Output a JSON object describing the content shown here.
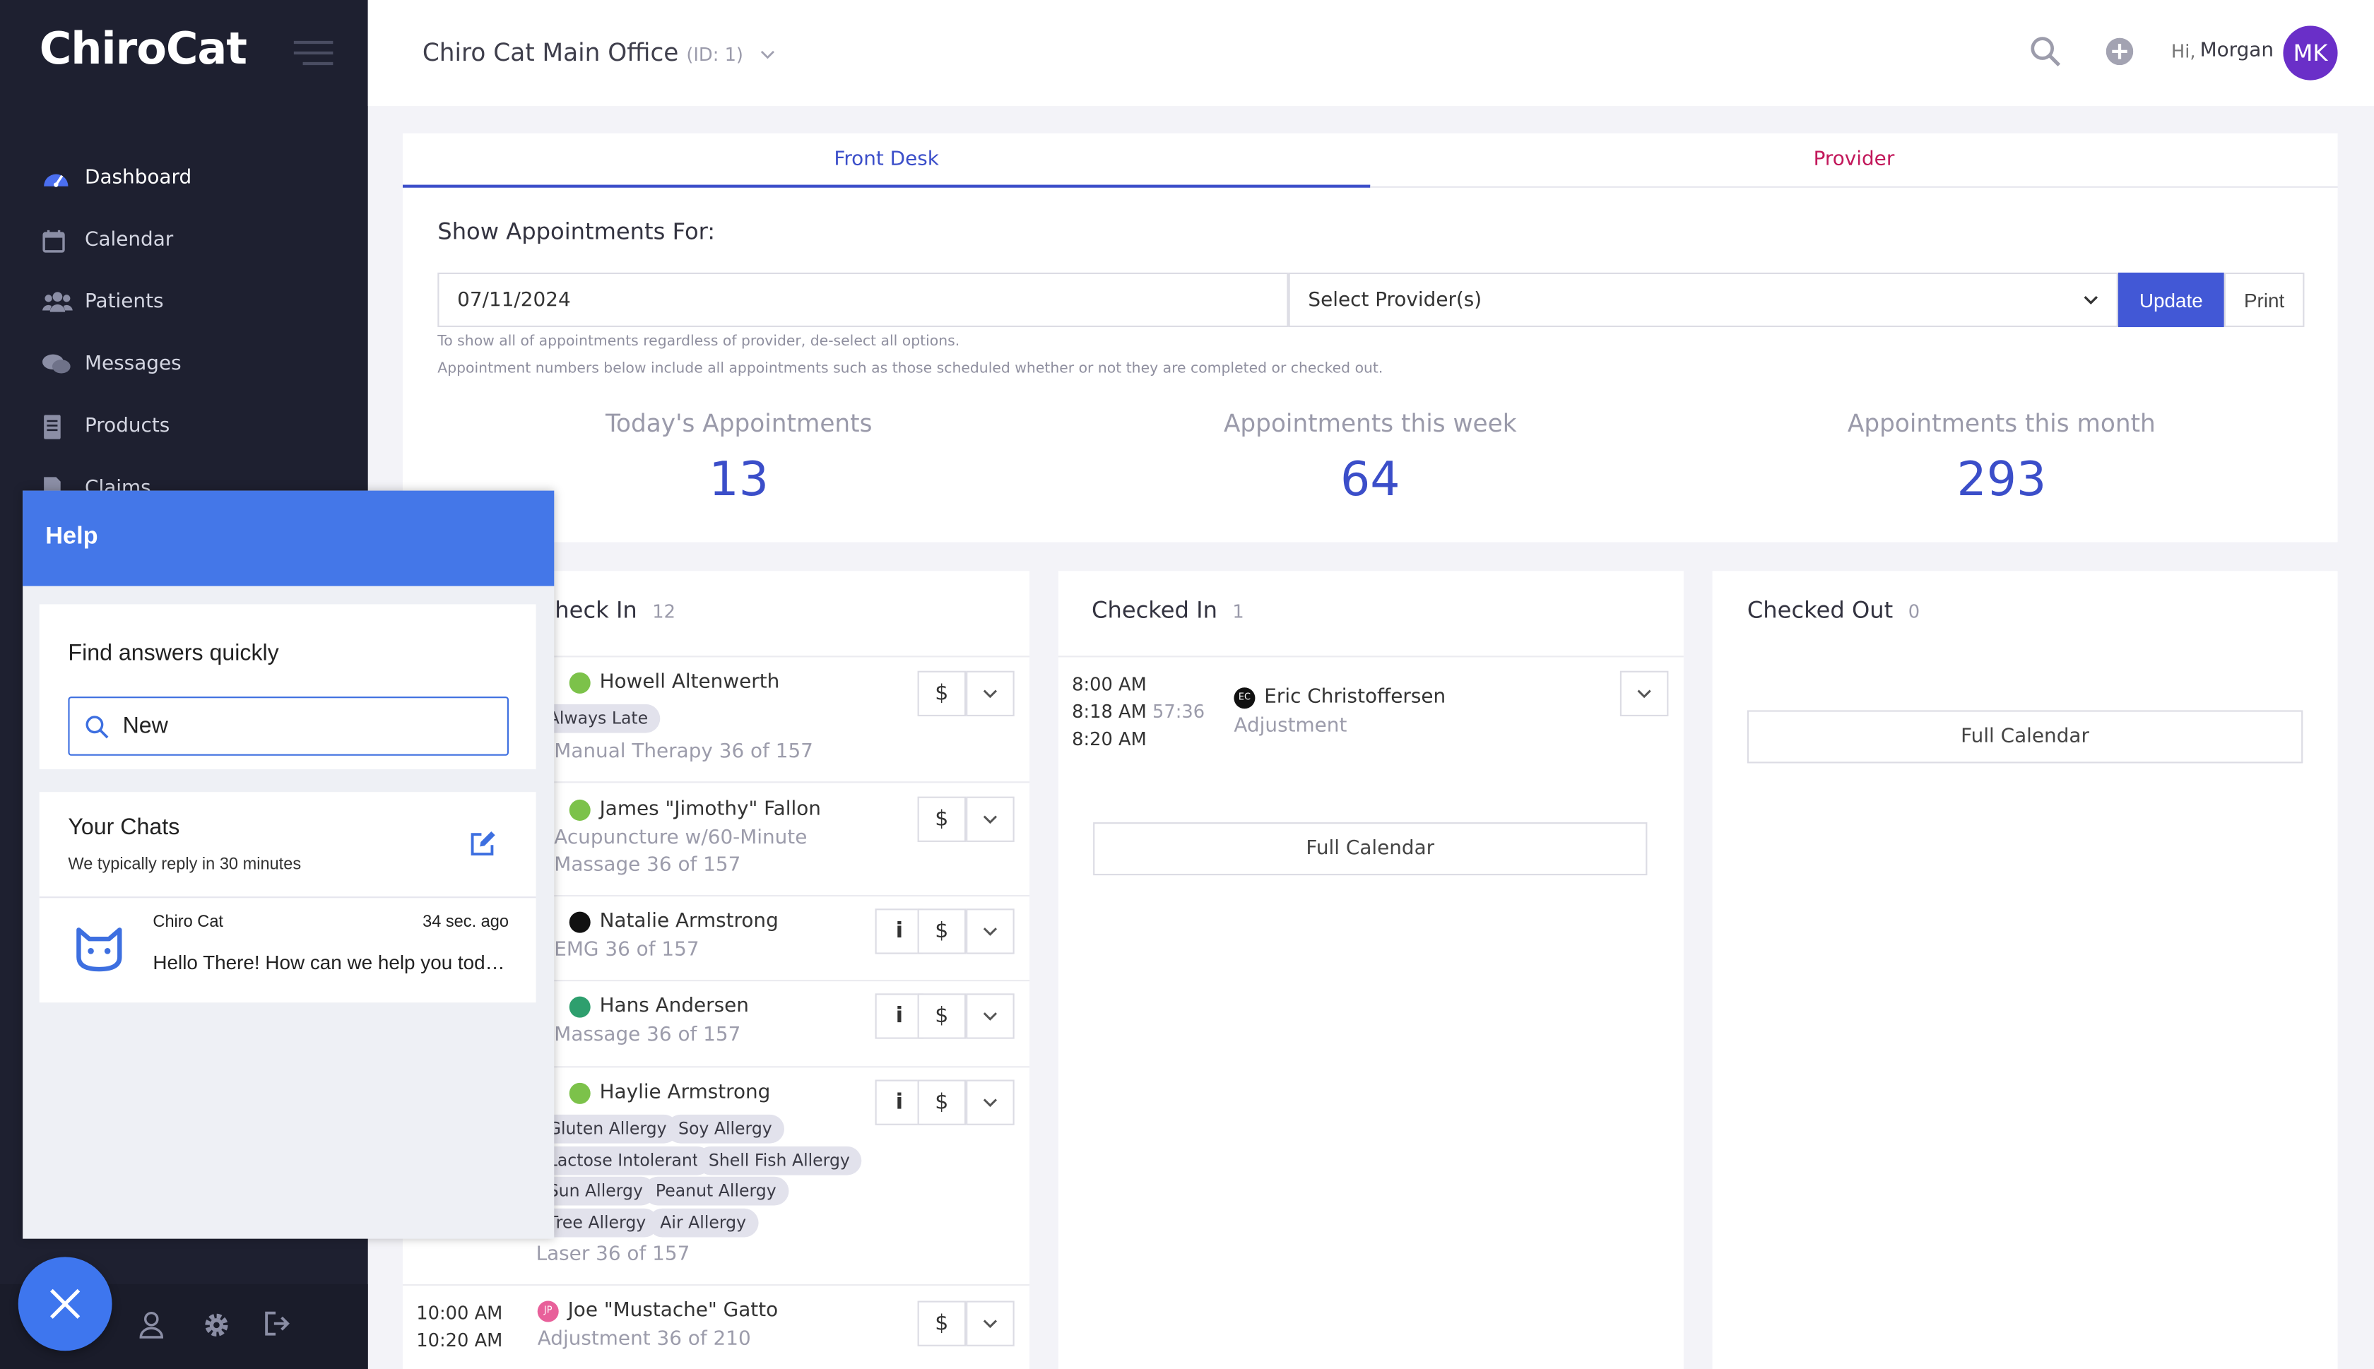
{
  "brand": {
    "logo": "ChiroCat"
  },
  "sidebar": {
    "items": [
      {
        "label": "Dashboard",
        "icon": "dashboard-icon"
      },
      {
        "label": "Calendar",
        "icon": "calendar-icon"
      },
      {
        "label": "Patients",
        "icon": "users-icon"
      },
      {
        "label": "Messages",
        "icon": "chat-icon"
      },
      {
        "label": "Products",
        "icon": "products-icon"
      },
      {
        "label": "Claims",
        "icon": "claims-icon"
      }
    ]
  },
  "header": {
    "office_name": "Chiro Cat Main Office",
    "office_id": "(ID: 1)",
    "greeting": "Hi,",
    "user_name": "Morgan",
    "avatar_initials": "MK"
  },
  "tabs": [
    {
      "label": "Front Desk"
    },
    {
      "label": "Provider"
    }
  ],
  "filters": {
    "title": "Show Appointments For:",
    "date": "07/11/2024",
    "provider_placeholder": "Select Provider(s)",
    "update_label": "Update",
    "print_label": "Print",
    "hint1": "To show all of appointments regardless of provider, de-select all options.",
    "hint2": "Appointment numbers below include all appointments such as those scheduled whether or not they are completed or checked out."
  },
  "stats": [
    {
      "label": "Today's Appointments",
      "value": "13"
    },
    {
      "label": "Appointments this week",
      "value": "64"
    },
    {
      "label": "Appointments this month",
      "value": "293"
    }
  ],
  "check_in": {
    "title": "Check In",
    "count": "12",
    "appointments": [
      {
        "name": "Howell Altenwerth",
        "tags": [
          "Always Late"
        ],
        "service": "Manual Therapy 36 of 157",
        "dot_color": "#7cc24a"
      },
      {
        "name": "James \"Jimothy\" Fallon",
        "service1": "Acupuncture w/60-Minute",
        "service2": "Massage 36 of 157",
        "dot_color": "#7cc24a"
      },
      {
        "name": "Natalie Armstrong",
        "service": "EMG 36 of 157",
        "dot_color": "#111111"
      },
      {
        "name": "Hans Andersen",
        "service": "Massage 36 of 157",
        "dot_color": "#2e9f6e"
      },
      {
        "name": "Haylie Armstrong",
        "tags": [
          "Gluten Allergy",
          "Soy Allergy",
          "Lactose Intolerant",
          "Shell Fish Allergy",
          "Sun Allergy",
          "Peanut Allergy",
          "Tree Allergy",
          "Air Allergy"
        ],
        "service": "Laser 36 of 157",
        "dot_color": "#7cc24a"
      },
      {
        "name": "Joe \"Mustache\" Gatto",
        "initials": "JP",
        "time1": "10:00 AM",
        "time2": "10:20 AM",
        "service": "Adjustment 36 of 210",
        "dot_color": "#e8609a"
      }
    ]
  },
  "checked_in": {
    "title": "Checked In",
    "count": "1",
    "appointment": {
      "time1": "8:00 AM",
      "time2": "8:18 AM",
      "elapsed": "57:36",
      "time3": "8:20 AM",
      "initials": "EC",
      "name": "Eric Christoffersen",
      "service": "Adjustment"
    },
    "full_calendar": "Full Calendar"
  },
  "checked_out": {
    "title": "Checked Out",
    "count": "0",
    "full_calendar": "Full Calendar"
  },
  "action_icons": {
    "info": "i",
    "billing": "$"
  },
  "help": {
    "title": "Help",
    "find_title": "Find answers quickly",
    "search_value": "New",
    "chats_title": "Your Chats",
    "chats_subtitle": "We typically reply in 30 minutes",
    "chat_sender": "Chiro Cat",
    "chat_time": "34 sec. ago",
    "chat_message": "Hello There! How can we help you today?"
  },
  "colors": {
    "accent": "#3b4ec9",
    "provider_tab": "#c2185b",
    "sidebar_bg": "#1e2030",
    "help_blue": "#4477e8"
  }
}
